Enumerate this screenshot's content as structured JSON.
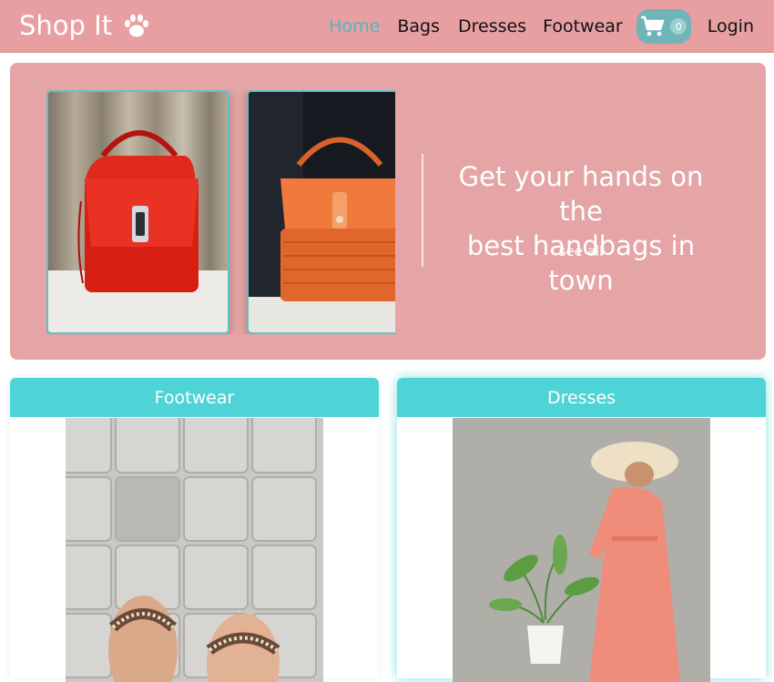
{
  "brand": {
    "name": "Shop It",
    "icon": "paw-icon"
  },
  "nav": {
    "home": "Home",
    "bags": "Bags",
    "dresses": "Dresses",
    "footwear": "Footwear",
    "cart_count": "0",
    "login": "Login",
    "active": "Home"
  },
  "hero": {
    "headline_line1": "Get your hands on the",
    "headline_line2": "best handbags in town",
    "link": "see all",
    "slides": [
      "red-handbag-image",
      "orange-wicker-handbag-image"
    ]
  },
  "categories": [
    {
      "title": "Footwear",
      "image": "sandals-on-tiles-image"
    },
    {
      "title": "Dresses",
      "image": "woman-in-coral-dress-image"
    }
  ],
  "colors": {
    "navbar": "#e89fa2",
    "hero": "#e5a4a5",
    "accent": "#4ed4d7",
    "active_link": "#4fb7bf",
    "cart": "#6fb4b7"
  }
}
